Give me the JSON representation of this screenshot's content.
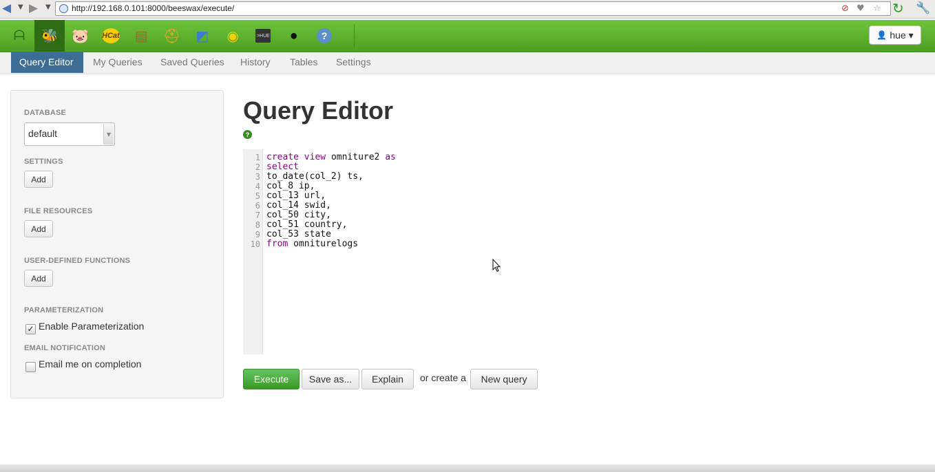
{
  "browser": {
    "url": "http://192.168.0.101:8000/beeswax/execute/",
    "back_icon": "back-arrow-icon",
    "forward_icon": "forward-arrow-icon"
  },
  "hue_apps": [
    {
      "name": "hue-home-icon",
      "glyph": "ᗩ",
      "color": "#2d6e18"
    },
    {
      "name": "beeswax-icon",
      "glyph": "🐝",
      "color": "#f2d21b"
    },
    {
      "name": "pig-icon",
      "glyph": "🐷",
      "color": "#f7a8b8"
    },
    {
      "name": "hcat-icon",
      "glyph": "HCat",
      "color": "#f4d000"
    },
    {
      "name": "file-browser-icon",
      "glyph": "▤",
      "color": "#8a6d3b"
    },
    {
      "name": "job-designer-icon",
      "glyph": "⛑",
      "color": "#f5a623"
    },
    {
      "name": "oozie-icon",
      "glyph": "◩",
      "color": "#3a7bd5"
    },
    {
      "name": "job-browser-icon",
      "glyph": "◉",
      "color": "#f3d000"
    },
    {
      "name": "shell-icon",
      "glyph": ">HUE",
      "color": "#333333"
    },
    {
      "name": "user-admin-icon",
      "glyph": "●",
      "color": "#111111"
    },
    {
      "name": "help-icon",
      "glyph": "?",
      "color": "#5b8fc9"
    }
  ],
  "user_menu": {
    "label": "hue ▾",
    "icon": "user-icon"
  },
  "tabs": [
    "Query Editor",
    "My Queries",
    "Saved Queries",
    "History",
    "Tables",
    "Settings"
  ],
  "sidebar": {
    "database_label": "DATABASE",
    "database_value": "default",
    "settings_label": "SETTINGS",
    "file_resources_label": "FILE RESOURCES",
    "udf_label": "USER-DEFINED FUNCTIONS",
    "add_label": "Add",
    "parameterization_label": "PARAMETERIZATION",
    "parameterization_checkbox": "Enable Parameterization",
    "email_label": "EMAIL NOTIFICATION",
    "email_checkbox": "Email me on completion"
  },
  "main": {
    "title": "Query Editor",
    "code": [
      "create view omniture2 as",
      "select",
      "to_date(col_2) ts,",
      "col_8 ip,",
      "col_13 url,",
      "col_14 swid,",
      "col_50 city,",
      "col_51 country,",
      "col_53 state",
      "from omniturelogs"
    ],
    "execute_label": "Execute",
    "save_as_label": "Save as...",
    "explain_label": "Explain",
    "or_create_text": "or create a",
    "new_query_label": "New query"
  }
}
